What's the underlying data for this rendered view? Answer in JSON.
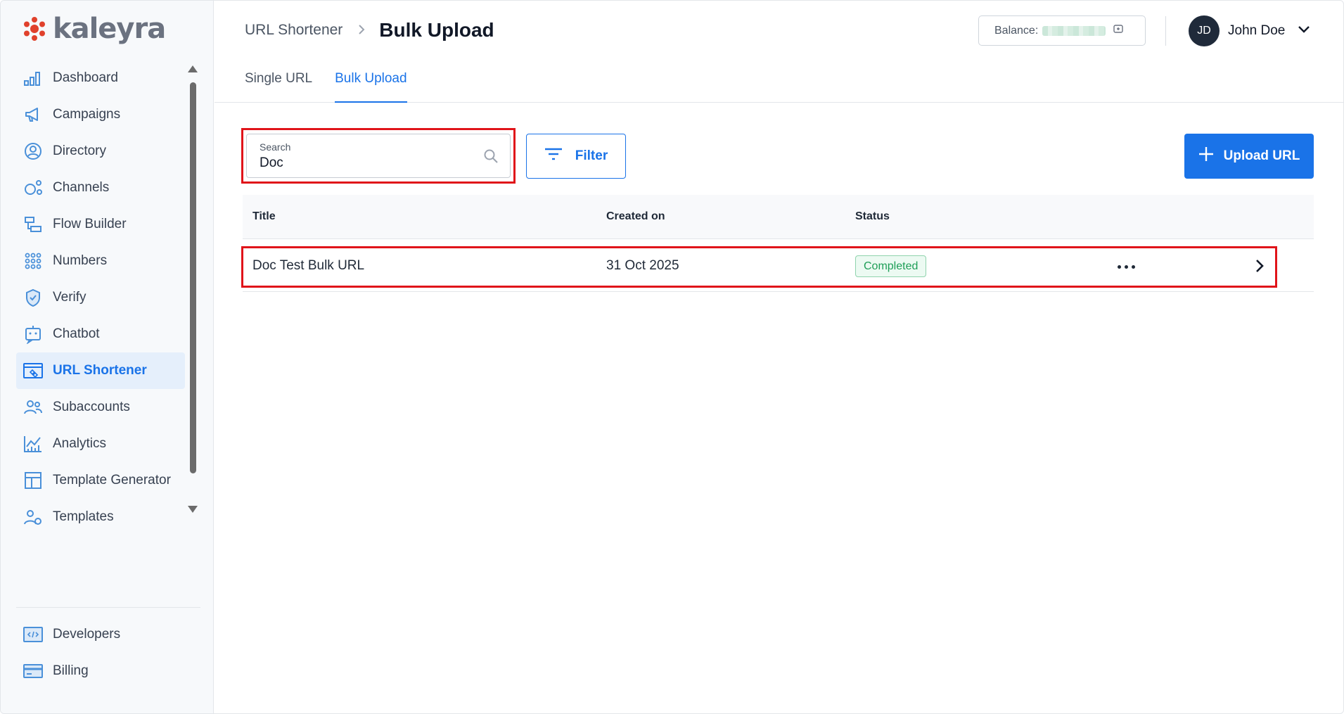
{
  "brand": {
    "name": "kaleyra",
    "logo_color": "#e0412c"
  },
  "sidebar": {
    "items": [
      {
        "label": "Dashboard",
        "icon": "dashboard-icon"
      },
      {
        "label": "Campaigns",
        "icon": "megaphone-icon"
      },
      {
        "label": "Directory",
        "icon": "contact-icon"
      },
      {
        "label": "Channels",
        "icon": "channels-icon"
      },
      {
        "label": "Flow Builder",
        "icon": "flow-builder-icon"
      },
      {
        "label": "Numbers",
        "icon": "numbers-grid-icon"
      },
      {
        "label": "Verify",
        "icon": "shield-check-icon"
      },
      {
        "label": "Chatbot",
        "icon": "chatbot-icon"
      },
      {
        "label": "URL Shortener",
        "icon": "link-icon",
        "active": true
      },
      {
        "label": "Subaccounts",
        "icon": "users-icon"
      },
      {
        "label": "Analytics",
        "icon": "analytics-icon"
      },
      {
        "label": "Template Generator",
        "icon": "template-generator-icon"
      },
      {
        "label": "Templates",
        "icon": "templates-icon"
      }
    ],
    "bottom_items": [
      {
        "label": "Developers",
        "icon": "code-icon"
      },
      {
        "label": "Billing",
        "icon": "billing-card-icon"
      }
    ]
  },
  "header": {
    "breadcrumb_parent": "URL Shortener",
    "breadcrumb_current": "Bulk Upload",
    "balance_label": "Balance:",
    "user": {
      "initials": "JD",
      "name": "John Doe"
    }
  },
  "tabs": [
    {
      "label": "Single URL",
      "active": false
    },
    {
      "label": "Bulk Upload",
      "active": true
    }
  ],
  "search": {
    "label": "Search",
    "value": "Doc"
  },
  "filter_label": "Filter",
  "upload_label": "Upload URL",
  "table": {
    "columns": [
      "Title",
      "Created on",
      "Status"
    ],
    "rows": [
      {
        "title": "Doc Test Bulk URL",
        "created_on": "31 Oct 2025",
        "status": "Completed"
      }
    ]
  },
  "colors": {
    "accent": "#1a73e8",
    "highlight_box": "#e0141a",
    "status_completed": "#1e9e57"
  }
}
